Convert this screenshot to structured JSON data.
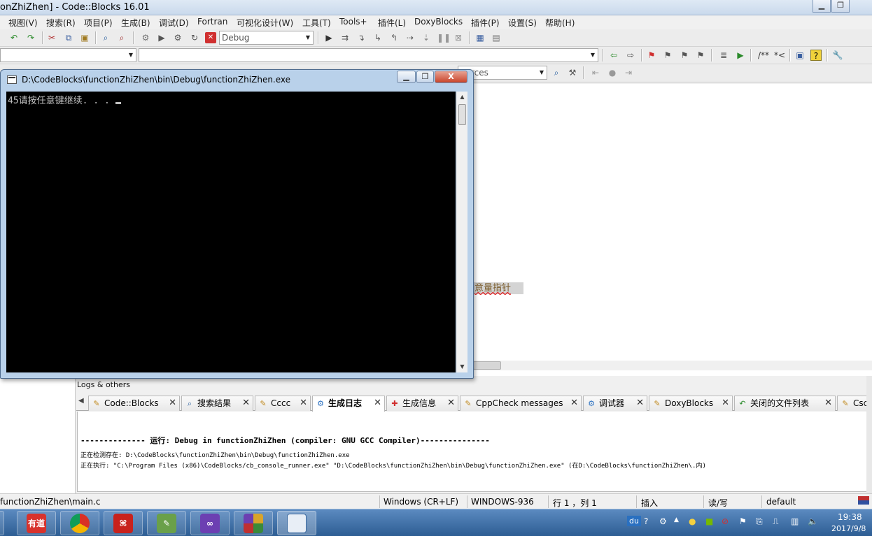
{
  "window": {
    "title": "onZhiZhen] - Code::Blocks 16.01",
    "minimize": "▁",
    "maximize": "❐"
  },
  "menu": [
    "视图(V)",
    "搜索(R)",
    "项目(P)",
    "生成(B)",
    "调试(D)",
    "Fortran",
    "可视化设计(W)",
    "工具(T)",
    "Tools+",
    "插件(L)",
    "DoxyBlocks",
    "插件(P)",
    "设置(S)",
    "帮助(H)"
  ],
  "toolbar": {
    "build_target": "Debug",
    "code_completion_scope": "",
    "code_completion_symbol": "",
    "comment_block": "/**",
    "comment_line": "*<",
    "search_scope": "ources"
  },
  "editor": {
    "highlighted_text": "意量指针"
  },
  "console": {
    "title": "D:\\CodeBlocks\\functionZhiZhen\\bin\\Debug\\functionZhiZhen.exe",
    "output": "45请按任意键继续. . .",
    "minimize": "▁",
    "maximize": "❐",
    "close": "X"
  },
  "logs": {
    "panel_title": "Logs & others",
    "tabs": [
      {
        "label": "Code::Blocks",
        "icon": "doc-icon"
      },
      {
        "label": "搜索结果",
        "icon": "search-icon"
      },
      {
        "label": "Cccc",
        "icon": "doc-icon"
      },
      {
        "label": "生成日志",
        "icon": "gear-icon"
      },
      {
        "label": "生成信息",
        "icon": "pin-icon"
      },
      {
        "label": "CppCheck messages",
        "icon": "doc-icon"
      },
      {
        "label": "调试器",
        "icon": "gear-icon"
      },
      {
        "label": "DoxyBlocks",
        "icon": "doc-icon"
      },
      {
        "label": "关闭的文件列表",
        "icon": "arrow-icon"
      },
      {
        "label": "Csco",
        "icon": "doc-icon"
      }
    ],
    "line1": "-------------- 运行: Debug in functionZhiZhen (compiler: GNU GCC Compiler)---------------",
    "line2": "正在检测存在:  D:\\CodeBlocks\\functionZhiZhen\\bin\\Debug\\functionZhiZhen.exe",
    "line3": "正在执行:  \"C:\\Program Files (x86)\\CodeBlocks/cb_console_runner.exe\" \"D:\\CodeBlocks\\functionZhiZhen\\bin\\Debug\\functionZhiZhen.exe\"  (在D:\\CodeBlocks\\functionZhiZhen\\.内)"
  },
  "status": {
    "file": "functionZhiZhen\\main.c",
    "line_endings": "Windows (CR+LF)",
    "encoding": "WINDOWS-936",
    "position": "行 1 ，列 1",
    "mode": "插入",
    "access": "读/写",
    "profile": "default"
  },
  "taskbar": {
    "apps": [
      {
        "name": "youdao",
        "label": "有道",
        "color": "#d8322c"
      },
      {
        "name": "chrome",
        "label": "",
        "color": "#e0b83a"
      },
      {
        "name": "acrobat",
        "label": "",
        "color": "#c8221d"
      },
      {
        "name": "notepad",
        "label": "",
        "color": "#6aa04a"
      },
      {
        "name": "visual-studio",
        "label": "",
        "color": "#6c3fb2"
      },
      {
        "name": "codeblocks",
        "label": "",
        "color": "#d9a42a"
      },
      {
        "name": "console",
        "label": "",
        "color": "#3b6aa0"
      }
    ],
    "tray_input": "du",
    "time": "19:38",
    "date": "2017/9/8"
  }
}
